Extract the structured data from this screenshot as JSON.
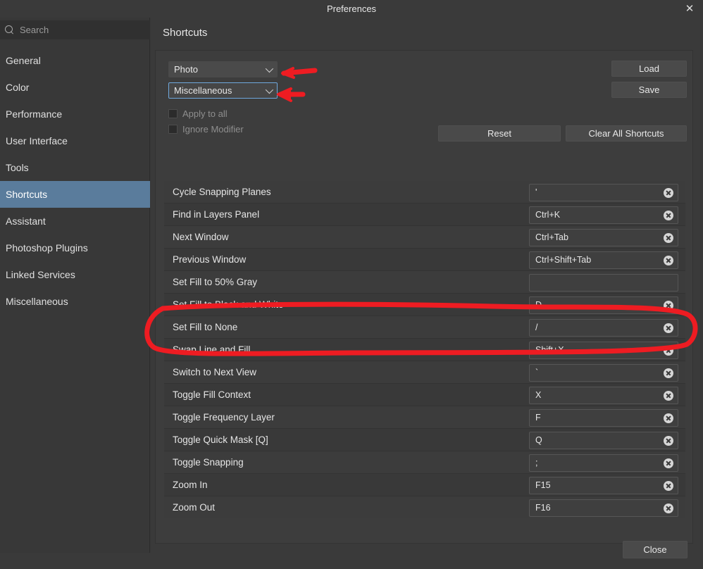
{
  "window": {
    "title": "Preferences",
    "close_icon": "close-icon",
    "close_label": "✕"
  },
  "sidebar": {
    "search": {
      "placeholder": "Search",
      "value": "",
      "icon": "search-icon"
    },
    "items": [
      {
        "label": "General",
        "selected": false
      },
      {
        "label": "Color",
        "selected": false
      },
      {
        "label": "Performance",
        "selected": false
      },
      {
        "label": "User Interface",
        "selected": false
      },
      {
        "label": "Tools",
        "selected": false
      },
      {
        "label": "Shortcuts",
        "selected": true
      },
      {
        "label": "Assistant",
        "selected": false
      },
      {
        "label": "Photoshop Plugins",
        "selected": false
      },
      {
        "label": "Linked Services",
        "selected": false
      },
      {
        "label": "Miscellaneous",
        "selected": false
      }
    ]
  },
  "main": {
    "page_title": "Shortcuts",
    "dropdowns": [
      {
        "name": "persona-select",
        "value": "Photo",
        "focused": false
      },
      {
        "name": "category-select",
        "value": "Miscellaneous",
        "focused": true
      }
    ],
    "checkboxes": [
      {
        "label": "Apply to all",
        "checked": false,
        "disabled": true
      },
      {
        "label": "Ignore Modifier",
        "checked": false,
        "disabled": true
      }
    ],
    "buttons": {
      "load": "Load",
      "save": "Save",
      "reset": "Reset",
      "clear_all": "Clear All Shortcuts"
    },
    "shortcuts": [
      {
        "command": "Cycle Snapping Planes",
        "keys": "'"
      },
      {
        "command": "Find in Layers Panel",
        "keys": "Ctrl+K"
      },
      {
        "command": "Next Window",
        "keys": "Ctrl+Tab"
      },
      {
        "command": "Previous Window",
        "keys": "Ctrl+Shift+Tab"
      },
      {
        "command": "Set Fill to 50% Gray",
        "keys": ""
      },
      {
        "command": "Set Fill to Black and White",
        "keys": "D"
      },
      {
        "command": "Set Fill to None",
        "keys": "/"
      },
      {
        "command": "Swap Line and Fill",
        "keys": "Shift+X"
      },
      {
        "command": "Switch to Next View",
        "keys": "`"
      },
      {
        "command": "Toggle Fill Context",
        "keys": "X"
      },
      {
        "command": "Toggle Frequency Layer",
        "keys": "F"
      },
      {
        "command": "Toggle Quick Mask [Q]",
        "keys": "Q"
      },
      {
        "command": "Toggle Snapping",
        "keys": ";"
      },
      {
        "command": "Zoom In",
        "keys": "F15"
      },
      {
        "command": "Zoom Out",
        "keys": "F16"
      }
    ]
  },
  "footer": {
    "close_label": "Close"
  },
  "annotations": {
    "color": "#ee1c22",
    "items": [
      {
        "type": "arrow",
        "name": "arrow-to-persona-select"
      },
      {
        "type": "arrow",
        "name": "arrow-to-category-select"
      },
      {
        "type": "ellipse",
        "name": "highlight-swap-line-and-fill"
      }
    ]
  },
  "colors": {
    "window_bg": "#383838",
    "panel_bg": "#3d3d3d",
    "selection": "#5a7c9c",
    "focus_border": "#6fa8dc",
    "annotation_red": "#ee1c22"
  }
}
